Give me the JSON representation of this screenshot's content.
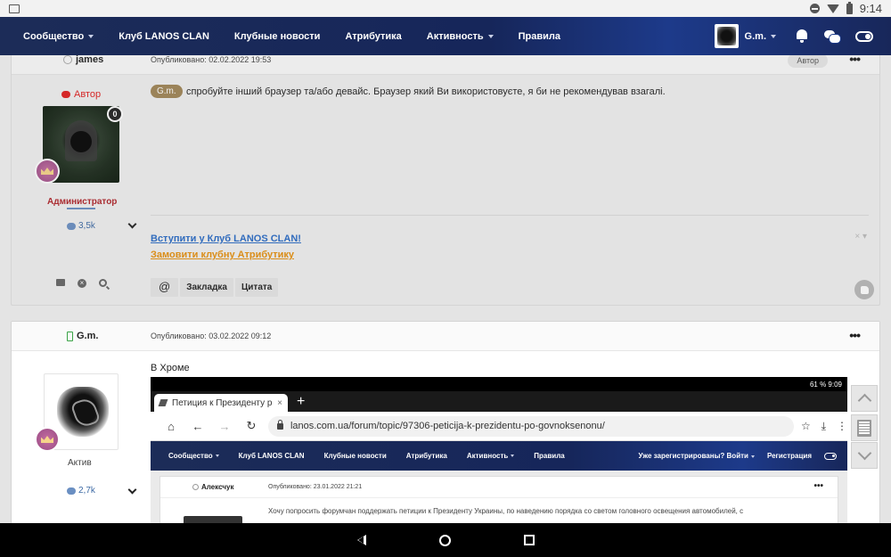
{
  "status_bar": {
    "time": "9:14"
  },
  "nav": {
    "items": [
      {
        "label": "Сообщество",
        "dropdown": true
      },
      {
        "label": "Клуб LANOS CLAN",
        "dropdown": false
      },
      {
        "label": "Клубные новости",
        "dropdown": false
      },
      {
        "label": "Атрибутика",
        "dropdown": false
      },
      {
        "label": "Активность",
        "dropdown": true
      },
      {
        "label": "Правила",
        "dropdown": false
      }
    ],
    "user_name": "G.m."
  },
  "post1": {
    "author": "james",
    "date": "Опубликовано: 02.02.2022 19:53",
    "badge": "Автор",
    "author_role_label": "Автор",
    "group": "Администратор",
    "reputation": "3,5k",
    "mention": "G.m.",
    "text": "спробуйте інший браузер та/або девайс. Браузер який Ви використовуєте, я би не рекомендував взагалі.",
    "link_join": "Вступити у Клуб LANOS CLAN!",
    "link_merch": "Замовити клубну Атрибутику",
    "close_glyph": "× ▾",
    "action_at": "@",
    "action_bookmark": "Закладка",
    "action_quote": "Цитата",
    "shield_glyph": "0"
  },
  "post2": {
    "author": "G.m.",
    "date": "Опубликовано: 03.02.2022 09:12",
    "group": "Актив",
    "reputation": "2,7k",
    "text": "В Хроме"
  },
  "embedded_screenshot": {
    "status": "61 %  9:09",
    "tab_title": "Петиция к Президенту р",
    "tab_close": "×",
    "new_tab": "+",
    "url": "lanos.com.ua/forum/topic/97306-peticija-k-prezidentu-po-govnoksenonu/",
    "nav_items": [
      {
        "label": "Сообщество",
        "dropdown": true
      },
      {
        "label": "Клуб LANOS CLAN",
        "dropdown": false
      },
      {
        "label": "Клубные новости",
        "dropdown": false
      },
      {
        "label": "Атрибутика",
        "dropdown": false
      },
      {
        "label": "Активность",
        "dropdown": true
      },
      {
        "label": "Правила",
        "dropdown": false
      }
    ],
    "login_prompt": "Уже зарегистрированы? Войти",
    "register": "Регистрация",
    "post_author": "Алексчук",
    "post_date": "Опубликовано: 23.01.2022 21:21",
    "post_text": "Хочу попросить форумчан поддержать петиции к Президенту Украины, по наведению порядка со светом головного освещения автомобилей, с"
  },
  "glyphs": {
    "more": "•••",
    "back": "←",
    "forward": "→",
    "reload": "↻",
    "home": "⌂",
    "star": "☆",
    "download": "⤓",
    "menu": "⋮",
    "x_small": "×"
  }
}
